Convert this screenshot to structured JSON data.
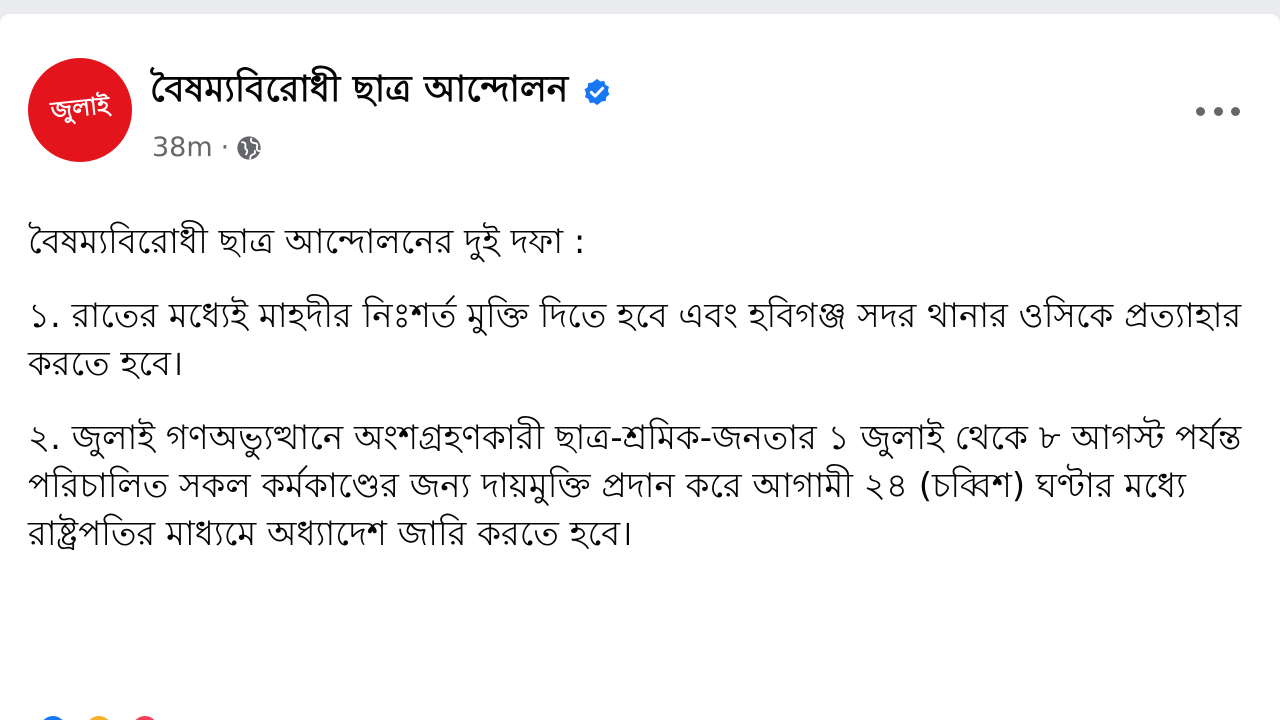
{
  "post": {
    "avatar_text": "জুলাই",
    "page_name": "বৈষম্যবিরোধী ছাত্র আন্দোলন",
    "time": "38m",
    "separator": "·",
    "paragraphs": [
      "বৈষম্যবিরোধী ছাত্র আন্দোলনের দুই দফা :",
      "১. রাতের মধ্যেই মাহদীর নিঃশর্ত মুক্তি দিতে হবে এবং হবিগঞ্জ সদর থানার ওসিকে প্রত্যাহার করতে হবে।",
      "২. জুলাই গণঅভ্যুত্থানে অংশগ্রহণকারী ছাত্র-শ্রমিক-জনতার ১ জুলাই থেকে ৮ আগস্ট পর্যন্ত পরিচালিত সকল কর্মকাণ্ডের জন্য দায়মুক্তি প্রদান করে আগামী ২৪ (চব্বিশ) ঘণ্টার মধ্যে রাষ্ট্রপতির মাধ্যমে অধ্যাদেশ জারি করতে হবে।"
    ]
  },
  "icons": {
    "verified": "verified-badge-icon",
    "audience": "globe-icon",
    "more": "more-options-icon"
  },
  "colors": {
    "avatar_bg": "#e3141c",
    "verified_blue": "#1877f2",
    "meta_gray": "#65676b",
    "text": "#050505"
  }
}
